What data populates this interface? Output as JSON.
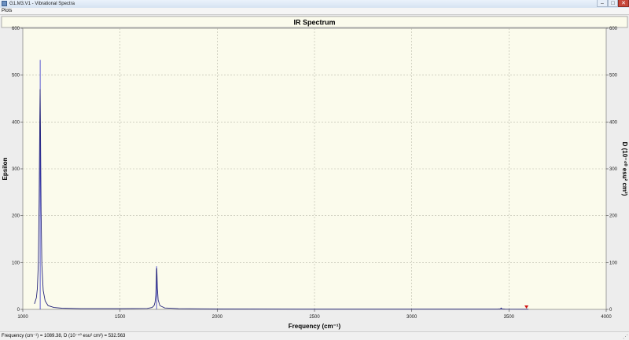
{
  "window": {
    "title": "G1.M3.V1 - Vibrational Spectra",
    "min_glyph": "–",
    "max_glyph": "□",
    "close_glyph": "✕"
  },
  "menu": {
    "items": [
      "Plots"
    ]
  },
  "status": {
    "text": "Frequency (cm⁻¹) = 1089.38, D (10⁻⁴⁰ esu² cm²) = 532.563",
    "grip": "⋰"
  },
  "colors": {
    "plot_bg": "#fbfbec",
    "line": "#24247a",
    "title_bg": "#fbfbec",
    "cursor": "#d01010"
  },
  "chart_data": {
    "type": "line",
    "title": "IR Spectrum",
    "xlabel": "Frequency (cm⁻¹)",
    "ylabel_left": "Epsilon",
    "ylabel_right": "D (10⁻⁴⁰ esu² cm²)",
    "xlim": [
      1000,
      4000
    ],
    "ylim_left": [
      0,
      600
    ],
    "ylim_right": [
      0,
      600
    ],
    "x_ticks": [
      1000,
      1500,
      2000,
      2500,
      3000,
      3500,
      4000
    ],
    "y_ticks_left": [
      0,
      100,
      200,
      300,
      400,
      500,
      600
    ],
    "y_ticks_right": [
      0,
      100,
      200,
      300,
      400,
      500,
      600
    ],
    "grid": true,
    "series": [
      {
        "name": "Epsilon",
        "x": [
          1060,
          1070,
          1075,
          1080,
          1084,
          1087,
          1089,
          1091,
          1094,
          1098,
          1105,
          1115,
          1130,
          1160,
          1200,
          1300,
          1500,
          1640,
          1665,
          1675,
          1680,
          1684,
          1686,
          1687,
          1688,
          1689,
          1690,
          1692,
          1696,
          1705,
          1730,
          1800,
          2000,
          2500,
          3000,
          3440,
          3455,
          3460,
          3465,
          3480,
          3600
        ],
        "y": [
          12,
          25,
          45,
          100,
          230,
          390,
          470,
          380,
          210,
          95,
          40,
          18,
          8,
          4,
          2.5,
          1.5,
          1.5,
          2,
          4,
          8,
          15,
          30,
          55,
          75,
          87,
          88,
          75,
          45,
          20,
          8,
          3,
          1.5,
          1,
          0.5,
          0.5,
          0.5,
          1,
          3,
          1,
          0.5,
          0.3
        ]
      },
      {
        "name": "D",
        "sticks": [
          {
            "x": 1089.38,
            "y": 532.563
          },
          {
            "x": 1688,
            "y": 92
          },
          {
            "x": 3460,
            "y": 3
          }
        ]
      }
    ],
    "cursor_marker": {
      "x": 3590,
      "y": 0
    }
  }
}
